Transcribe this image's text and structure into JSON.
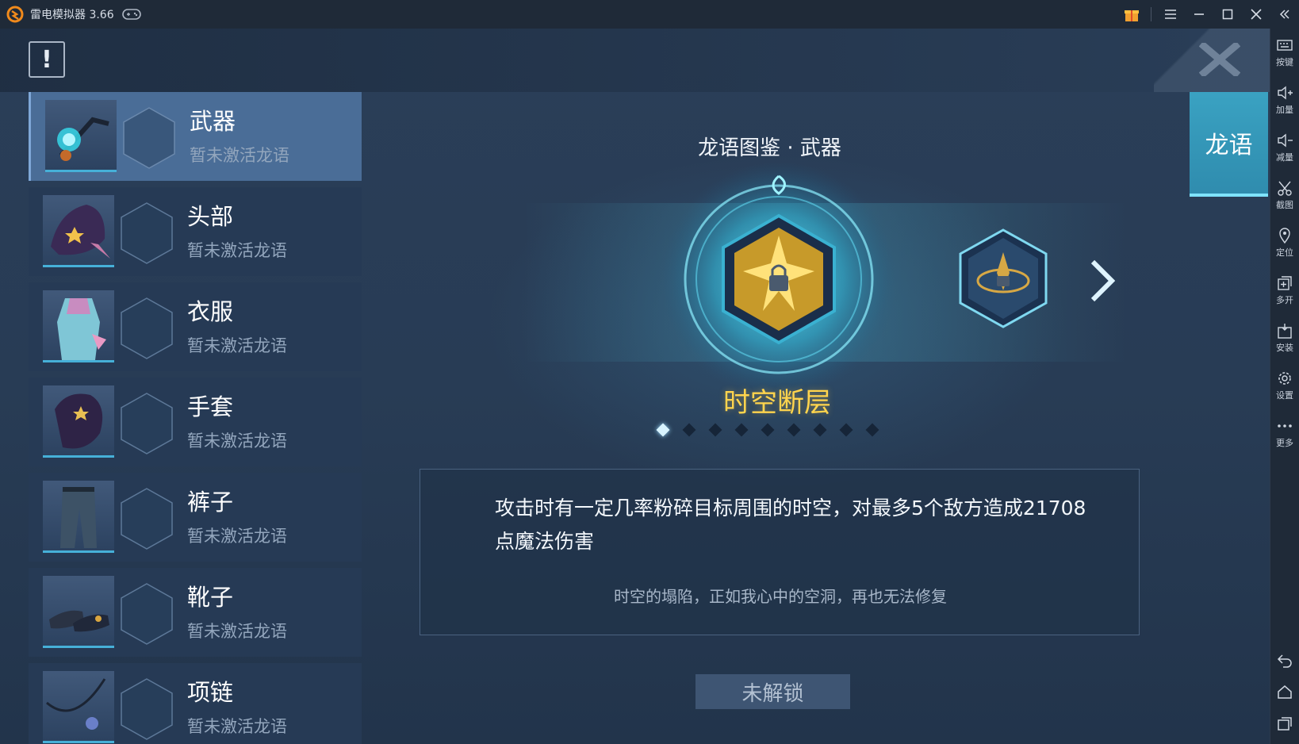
{
  "window": {
    "title": "雷电模拟器 3.66",
    "accent_color": "#f08a1c"
  },
  "emulator_toolbar": {
    "items": [
      {
        "label": "按键",
        "icon": "keyboard-icon"
      },
      {
        "label": "加量",
        "icon": "volume-up-icon"
      },
      {
        "label": "减量",
        "icon": "volume-down-icon"
      },
      {
        "label": "截图",
        "icon": "scissors-icon"
      },
      {
        "label": "定位",
        "icon": "location-pin-icon"
      },
      {
        "label": "多开",
        "icon": "multi-open-icon"
      },
      {
        "label": "安装",
        "icon": "apk-install-icon"
      },
      {
        "label": "设置",
        "icon": "gear-icon"
      },
      {
        "label": "更多",
        "icon": "more-dots-icon"
      }
    ],
    "bottom_icons": [
      "back-icon",
      "home-icon",
      "recent-apps-icon"
    ]
  },
  "game": {
    "alert_glyph": "!",
    "side_tab": "龙语",
    "equipment": [
      {
        "name": "武器",
        "status": "暂未激活龙语",
        "active": true
      },
      {
        "name": "头部",
        "status": "暂未激活龙语",
        "active": false
      },
      {
        "name": "衣服",
        "status": "暂未激活龙语",
        "active": false
      },
      {
        "name": "手套",
        "status": "暂未激活龙语",
        "active": false
      },
      {
        "name": "裤子",
        "status": "暂未激活龙语",
        "active": false
      },
      {
        "name": "靴子",
        "status": "暂未激活龙语",
        "active": false
      },
      {
        "name": "项链",
        "status": "暂未激活龙语",
        "active": false
      }
    ],
    "codex_title": "龙语图鉴 · 武器",
    "emblem_name": "时空断层",
    "page_count": 9,
    "page_current": 1,
    "description": "攻击时有一定几率粉碎目标周围的时空，对最多5个敌方造成21708点魔法伤害",
    "flavor_text": "时空的塌陷，正如我心中的空洞，再也无法修复",
    "unlock_button": "未解锁",
    "emblem_color": "#ffd44d"
  }
}
